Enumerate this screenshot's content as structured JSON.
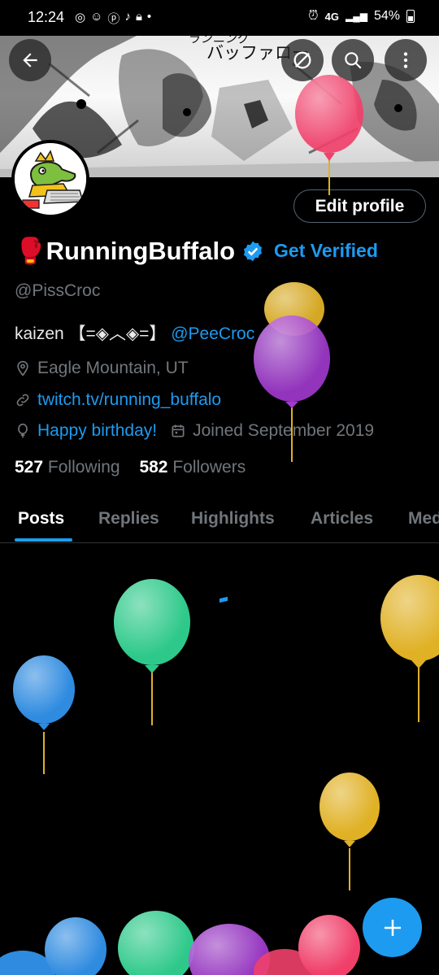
{
  "status_bar": {
    "time": "12:24",
    "network": "4G",
    "battery": "54%"
  },
  "banner": {
    "text_line1": "ランニング",
    "text_line2": "バッファロー"
  },
  "profile": {
    "name": "🥊RunningBuffalo",
    "get_verified": "Get Verified",
    "handle": "@PissCroc",
    "bio_text": "kaizen 【=◈︿◈=】",
    "bio_mention": "@PeeCroc",
    "location": "Eagle Mountain, UT",
    "website": "twitch.tv/running_buffalo",
    "birthday": "Happy birthday!",
    "joined": "Joined September 2019",
    "following_count": "527",
    "following_label": "Following",
    "followers_count": "582",
    "followers_label": "Followers",
    "edit_profile": "Edit profile"
  },
  "tabs": [
    "Posts",
    "Replies",
    "Highlights",
    "Articles",
    "Media"
  ],
  "active_tab": "Posts",
  "icons": {
    "back": "arrow-left-icon",
    "grok": "no-sign-icon",
    "search": "search-icon",
    "more": "more-vertical-icon",
    "verified": "verified-badge-icon",
    "location": "location-pin-icon",
    "link": "link-icon",
    "birthday": "balloon-icon",
    "joined": "calendar-icon",
    "compose": "plus-icon"
  },
  "colors": {
    "accent": "#1d9bf0",
    "background": "#000000",
    "secondary_text": "#71767b",
    "balloon_pink": "#f0406a",
    "balloon_yellow": "#e0b125",
    "balloon_purple": "#a23ad0",
    "balloon_green": "#2ec98a",
    "balloon_blue": "#2f8be0"
  }
}
